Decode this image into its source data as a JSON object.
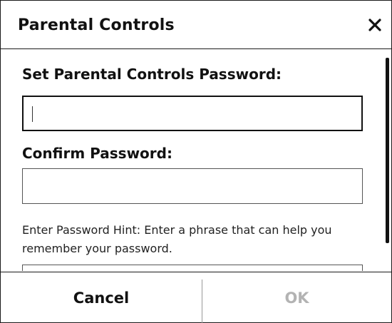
{
  "dialog": {
    "title": "Parental Controls",
    "close_icon": "close-icon"
  },
  "form": {
    "password_label": "Set Parental Controls Password:",
    "password_value": "",
    "confirm_label": "Confirm Password:",
    "confirm_value": "",
    "hint_label": "Enter Password Hint: Enter a phrase that can help you remember your password.",
    "hint_value": ""
  },
  "footer": {
    "cancel_label": "Cancel",
    "ok_label": "OK"
  },
  "colors": {
    "border": "#1a1a1a",
    "ok_disabled": "#b3b3b3"
  }
}
